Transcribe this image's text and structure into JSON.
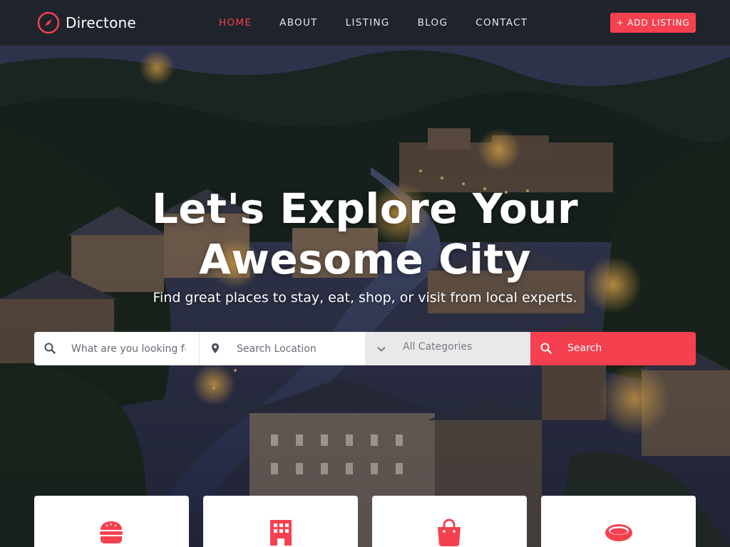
{
  "brand": {
    "name": "Directone",
    "accent": "#f5404f",
    "icon": "compass-icon"
  },
  "nav": {
    "items": [
      {
        "label": "HOME",
        "active": true
      },
      {
        "label": "ABOUT",
        "active": false
      },
      {
        "label": "LISTING",
        "active": false
      },
      {
        "label": "BLOG",
        "active": false
      },
      {
        "label": "CONTACT",
        "active": false
      }
    ],
    "add_listing_label": "+ ADD LISTING"
  },
  "hero": {
    "title": "Let's Explore Your Awesome City",
    "subtitle": "Find great places to stay, eat, shop, or visit from local experts."
  },
  "search": {
    "keyword_placeholder": "What are you looking for?",
    "keyword_icon": "search-icon",
    "location_placeholder": "Search Location",
    "location_icon": "map-pin-icon",
    "category_selected": "All Categories",
    "category_icon": "chevron-down-icon",
    "button_label": "Search",
    "button_icon": "search-icon"
  },
  "categories": [
    {
      "icon": "burger-icon"
    },
    {
      "icon": "hotel-icon"
    },
    {
      "icon": "shopping-bag-icon"
    },
    {
      "icon": "ring-icon"
    }
  ],
  "colors": {
    "header_bg": "#1f232b",
    "accent": "#f5404f",
    "select_bg": "#e9e9ea"
  }
}
